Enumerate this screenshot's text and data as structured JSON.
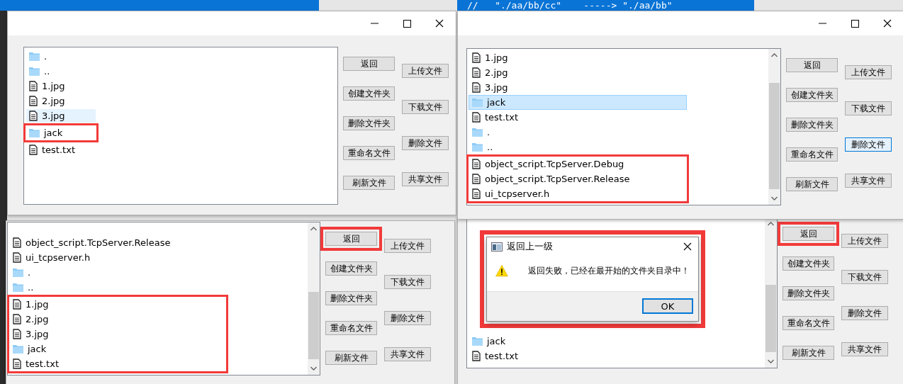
{
  "windows": [
    {
      "title_bar": true,
      "scrollbar": false,
      "files": [
        {
          "name": ".",
          "kind": "folder",
          "selected": false,
          "hovered": false,
          "highlighted": false
        },
        {
          "name": "..",
          "kind": "folder",
          "selected": false,
          "hovered": false,
          "highlighted": false
        },
        {
          "name": "1.jpg",
          "kind": "file",
          "selected": false,
          "hovered": false,
          "highlighted": false
        },
        {
          "name": "2.jpg",
          "kind": "file",
          "selected": false,
          "hovered": false,
          "highlighted": false
        },
        {
          "name": "3.jpg",
          "kind": "file",
          "selected": false,
          "hovered": true,
          "highlighted": false
        },
        {
          "name": "jack",
          "kind": "folder",
          "selected": false,
          "hovered": false,
          "highlighted": true
        },
        {
          "name": "test.txt",
          "kind": "file",
          "selected": false,
          "hovered": false,
          "highlighted": false
        }
      ],
      "buttons": [
        {
          "label": "返回",
          "focused": false,
          "highlighted": false
        },
        {
          "label": "创建文件夹",
          "focused": false,
          "highlighted": false
        },
        {
          "label": "删除文件夹",
          "focused": false,
          "highlighted": false
        },
        {
          "label": "重命名文件",
          "focused": false,
          "highlighted": false
        },
        {
          "label": "刷新文件",
          "focused": false,
          "highlighted": false
        },
        {
          "label": "上传文件",
          "focused": false,
          "highlighted": false
        },
        {
          "label": "下载文件",
          "focused": false,
          "highlighted": false
        },
        {
          "label": "删除文件",
          "focused": false,
          "highlighted": false
        },
        {
          "label": "共享文件",
          "focused": false,
          "highlighted": false
        }
      ]
    },
    {
      "code_line": "//   \"./aa/bb/cc\"    -----> \"./aa/bb\"",
      "title_bar": true,
      "scrollbar": true,
      "files": [
        {
          "name": "1.jpg",
          "kind": "file",
          "selected": false,
          "hovered": false,
          "highlighted": false
        },
        {
          "name": "2.jpg",
          "kind": "file",
          "selected": false,
          "hovered": false,
          "highlighted": false
        },
        {
          "name": "3.jpg",
          "kind": "file",
          "selected": false,
          "hovered": false,
          "highlighted": false
        },
        {
          "name": "jack",
          "kind": "folder",
          "selected": true,
          "hovered": false,
          "highlighted": false
        },
        {
          "name": "test.txt",
          "kind": "file",
          "selected": false,
          "hovered": false,
          "highlighted": false
        },
        {
          "name": ".",
          "kind": "folder",
          "selected": false,
          "hovered": false,
          "highlighted": false
        },
        {
          "name": "..",
          "kind": "folder",
          "selected": false,
          "hovered": false,
          "highlighted": false
        },
        {
          "name": "object_script.TcpServer.Debug",
          "kind": "file",
          "selected": false,
          "hovered": false,
          "highlighted": true
        },
        {
          "name": "object_script.TcpServer.Release",
          "kind": "file",
          "selected": false,
          "hovered": false,
          "highlighted": true
        },
        {
          "name": "ui_tcpserver.h",
          "kind": "file",
          "selected": false,
          "hovered": false,
          "highlighted": true
        }
      ],
      "buttons": [
        {
          "label": "返回",
          "focused": false,
          "highlighted": false
        },
        {
          "label": "创建文件夹",
          "focused": false,
          "highlighted": false
        },
        {
          "label": "删除文件夹",
          "focused": false,
          "highlighted": false
        },
        {
          "label": "重命名文件",
          "focused": false,
          "highlighted": false
        },
        {
          "label": "刷新文件",
          "focused": false,
          "highlighted": false
        },
        {
          "label": "上传文件",
          "focused": false,
          "highlighted": false
        },
        {
          "label": "下载文件",
          "focused": false,
          "highlighted": false
        },
        {
          "label": "删除文件",
          "focused": true,
          "highlighted": false
        },
        {
          "label": "共享文件",
          "focused": false,
          "highlighted": false
        }
      ]
    },
    {
      "title_bar": false,
      "scrollbar": true,
      "files": [
        {
          "name": "object_script.TcpServer.Release",
          "kind": "file",
          "selected": false,
          "hovered": false,
          "highlighted": false
        },
        {
          "name": "ui_tcpserver.h",
          "kind": "file",
          "selected": false,
          "hovered": false,
          "highlighted": false
        },
        {
          "name": ".",
          "kind": "folder",
          "selected": false,
          "hovered": false,
          "highlighted": false
        },
        {
          "name": "..",
          "kind": "folder",
          "selected": false,
          "hovered": false,
          "highlighted": false
        },
        {
          "name": "1.jpg",
          "kind": "file",
          "selected": false,
          "hovered": false,
          "highlighted": true
        },
        {
          "name": "2.jpg",
          "kind": "file",
          "selected": false,
          "hovered": false,
          "highlighted": true
        },
        {
          "name": "3.jpg",
          "kind": "file",
          "selected": false,
          "hovered": false,
          "highlighted": true
        },
        {
          "name": "jack",
          "kind": "folder",
          "selected": false,
          "hovered": false,
          "highlighted": true
        },
        {
          "name": "test.txt",
          "kind": "file",
          "selected": false,
          "hovered": false,
          "highlighted": true
        }
      ],
      "buttons": [
        {
          "label": "返回",
          "focused": false,
          "highlighted": true
        },
        {
          "label": "创建文件夹",
          "focused": false,
          "highlighted": false
        },
        {
          "label": "删除文件夹",
          "focused": false,
          "highlighted": false
        },
        {
          "label": "重命名文件",
          "focused": false,
          "highlighted": false
        },
        {
          "label": "刷新文件",
          "focused": false,
          "highlighted": false
        },
        {
          "label": "上传文件",
          "focused": false,
          "highlighted": false
        },
        {
          "label": "下载文件",
          "focused": false,
          "highlighted": false
        },
        {
          "label": "删除文件",
          "focused": false,
          "highlighted": false
        },
        {
          "label": "共享文件",
          "focused": false,
          "highlighted": false
        }
      ]
    },
    {
      "title_bar": false,
      "scrollbar": true,
      "files": [
        {
          "name": "jack",
          "kind": "folder",
          "selected": false,
          "hovered": false,
          "highlighted": false
        },
        {
          "name": "test.txt",
          "kind": "file",
          "selected": false,
          "hovered": false,
          "highlighted": false
        }
      ],
      "buttons": [
        {
          "label": "返回",
          "focused": false,
          "highlighted": true
        },
        {
          "label": "创建文件夹",
          "focused": false,
          "highlighted": false
        },
        {
          "label": "删除文件夹",
          "focused": false,
          "highlighted": false
        },
        {
          "label": "重命名文件",
          "focused": false,
          "highlighted": false
        },
        {
          "label": "刷新文件",
          "focused": false,
          "highlighted": false
        },
        {
          "label": "上传文件",
          "focused": false,
          "highlighted": false
        },
        {
          "label": "下载文件",
          "focused": false,
          "highlighted": false
        },
        {
          "label": "删除文件",
          "focused": false,
          "highlighted": false
        },
        {
          "label": "共享文件",
          "focused": false,
          "highlighted": false
        }
      ],
      "dialog": {
        "title": "返回上一级",
        "message": "返回失败，已经在最开始的文件夹目录中！",
        "button": "OK",
        "highlighted": true
      }
    }
  ]
}
